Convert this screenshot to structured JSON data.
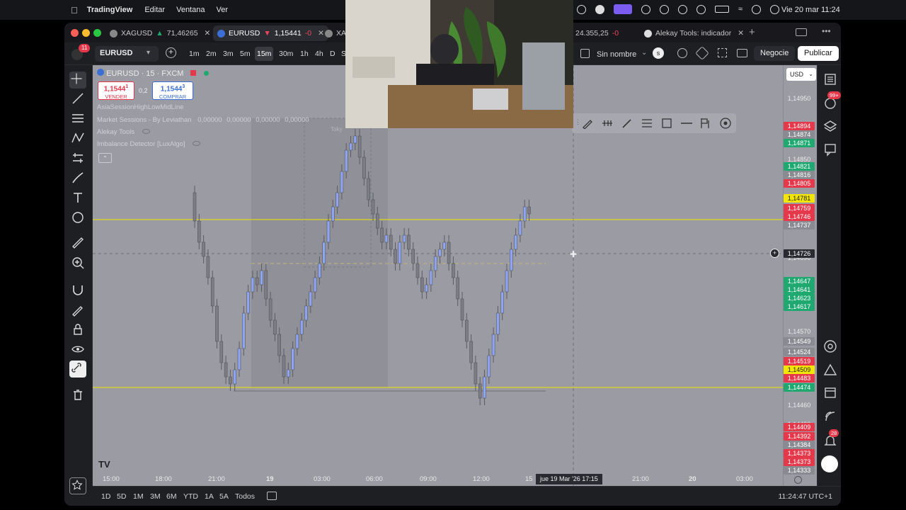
{
  "menubar": {
    "apple": "",
    "app": "TradingView",
    "items": [
      "Editar",
      "Ventana",
      "Ver"
    ],
    "clock": "Vie 20 mar 11:24"
  },
  "tabs": [
    {
      "label": "XAGUSD",
      "value": "71,46265",
      "trend": "up"
    },
    {
      "label": "EURUSD",
      "value": "1,15441",
      "change": "-0",
      "trend": "down"
    },
    {
      "label": "XAG"
    },
    {
      "label": "24.355,25",
      "change": "-0"
    },
    {
      "label": "Alekay Tools: indicador"
    }
  ],
  "toolbar": {
    "notifications": "11",
    "symbol": "EURUSD",
    "intervals": [
      "1m",
      "2m",
      "3m",
      "5m",
      "15m",
      "30m",
      "1h",
      "4h",
      "D",
      "S"
    ],
    "selected_interval": "15m",
    "layout_name": "Sin nombre",
    "layout_badge": "s",
    "trade_button": "Negocie",
    "publish_button": "Publicar"
  },
  "chart": {
    "legend": "EURUSD · 15 · FXCM",
    "sell_price": "1,1544",
    "sell_sup": "1",
    "sell_label": "VENDER",
    "spread": "0,2",
    "buy_price": "1,1544",
    "buy_sup": "3",
    "buy_label": "COMPRAR",
    "currency": "USD",
    "indicators": [
      "AsiaSessionHighLowMidLine",
      "Market Sessions - By Leviathan",
      "Alekay Tools",
      "Imbalance Detector [LuxAlgo]"
    ],
    "session_values": [
      "0,00000",
      "0,00000",
      "0,00000",
      "0,00000"
    ],
    "session_tag": "Toky",
    "crosshair_price": "1,14726",
    "crosshair_time": "jue 19 Mar '26   17:15",
    "price_ticks": [
      "1,14950",
      "1,14850",
      "1,14690",
      "1,14570",
      "1,14460",
      "1,14420"
    ],
    "price_labels": [
      {
        "v": "1,14894",
        "c": "#e5384a"
      },
      {
        "v": "1,14874",
        "c": "#8a8b92"
      },
      {
        "v": "1,14871",
        "c": "#1fa971"
      },
      {
        "v": "1,14821",
        "c": "#1fa971"
      },
      {
        "v": "1,14816",
        "c": "#8a8b92"
      },
      {
        "v": "1,14805",
        "c": "#e5384a"
      },
      {
        "v": "1,14781",
        "c": "#f2e600"
      },
      {
        "v": "1,14759",
        "c": "#e5384a"
      },
      {
        "v": "1,14746",
        "c": "#e5384a"
      },
      {
        "v": "1,14737",
        "c": "#8a8b92"
      },
      {
        "v": "1,14647",
        "c": "#1fa971"
      },
      {
        "v": "1,14641",
        "c": "#1fa971"
      },
      {
        "v": "1,14623",
        "c": "#1fa971"
      },
      {
        "v": "1,14617",
        "c": "#1fa971"
      },
      {
        "v": "1,14549",
        "c": "#8a8b92"
      },
      {
        "v": "1,14524",
        "c": "#8a8b92"
      },
      {
        "v": "1,14519",
        "c": "#e5384a"
      },
      {
        "v": "1,14509",
        "c": "#f2e600"
      },
      {
        "v": "1,14483",
        "c": "#e5384a"
      },
      {
        "v": "1,14474",
        "c": "#1fa971"
      },
      {
        "v": "1,14409",
        "c": "#e5384a"
      },
      {
        "v": "1,14392",
        "c": "#e5384a"
      },
      {
        "v": "1,14384",
        "c": "#8a8b92"
      },
      {
        "v": "1,14373",
        "c": "#e5384a"
      },
      {
        "v": "1,14373",
        "c": "#e5384a"
      },
      {
        "v": "1,14333",
        "c": "#8a8b92"
      }
    ],
    "time_labels": [
      "15:00",
      "18:00",
      "21:00",
      "19",
      "03:00",
      "06:00",
      "09:00",
      "12:00",
      "15",
      "21:00",
      "20",
      "03:00"
    ],
    "right_badges": {
      "alerts": "99+",
      "notifications": "28"
    }
  },
  "bottom": {
    "ranges": [
      "1D",
      "5D",
      "1M",
      "3M",
      "6M",
      "YTD",
      "1A",
      "5A",
      "Todos"
    ],
    "clock": "11:24:47 UTC+1"
  },
  "colors": {
    "up": "#8fa4ee",
    "down": "#7c7d86",
    "level": "#f2e600",
    "chart_bg": "#9a9ba3"
  }
}
